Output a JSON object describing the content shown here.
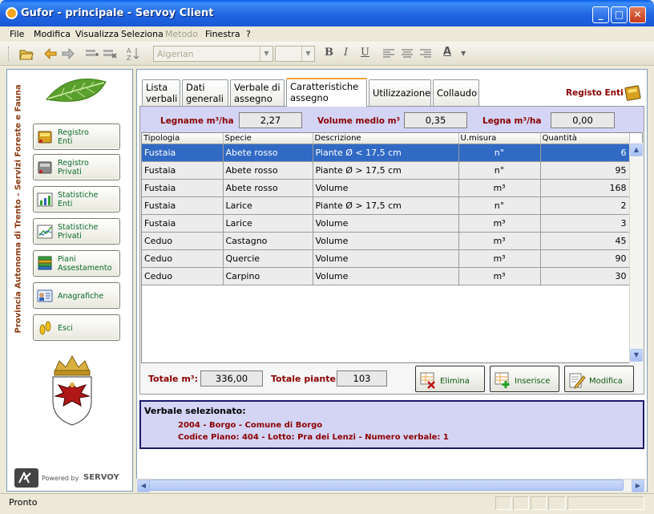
{
  "window": {
    "title": "Gufor - principale - Servoy Client",
    "min": "_",
    "max": "□",
    "close": "✕"
  },
  "menu": [
    "File",
    "Modifica",
    "Visualizza",
    "Seleziona",
    "Metodo",
    "Finestra",
    "?"
  ],
  "toolbar": {
    "font": "Algerian",
    "size": "",
    "bold": "B",
    "italic": "I",
    "underline": "U",
    "textcolor": "A"
  },
  "sidebar": {
    "vertical_label": "Provincia Autonoma di Trento - Servizi Foreste e Fauna",
    "items": [
      {
        "line1": "Registro",
        "line2": "Enti"
      },
      {
        "line1": "Registro",
        "line2": "Privati"
      },
      {
        "line1": "Statistiche",
        "line2": "Enti"
      },
      {
        "line1": "Statistiche",
        "line2": "Privati"
      },
      {
        "line1": "Piani",
        "line2": "Assestamento"
      },
      {
        "line1": "Anagrafiche",
        "line2": ""
      },
      {
        "line1": "Esci",
        "line2": ""
      }
    ],
    "powered_by": "Powered by",
    "brand": "SERVOY"
  },
  "tabs": [
    {
      "l1": "Lista",
      "l2": "verbali"
    },
    {
      "l1": "Dati",
      "l2": "generali"
    },
    {
      "l1": "Verbale di",
      "l2": "assegno"
    },
    {
      "l1": "Caratteristiche",
      "l2": "assegno"
    },
    {
      "l1": "Utilizzazione",
      "l2": ""
    },
    {
      "l1": "Collaudo",
      "l2": ""
    }
  ],
  "registo_link": "Registo Enti",
  "summary": {
    "legname_label": "Legname m³/ha",
    "legname_value": "2,27",
    "volume_label": "Volume medio m³",
    "volume_value": "0,35",
    "legna_label": "Legna m³/ha",
    "legna_value": "0,00"
  },
  "table": {
    "headers": [
      "Tipologia",
      "Specie",
      "Descrizione",
      "U.misura",
      "Quantità"
    ],
    "rows": [
      [
        "Fustaia",
        "Abete rosso",
        "Piante Ø < 17,5 cm",
        "n°",
        "6"
      ],
      [
        "Fustaia",
        "Abete rosso",
        "Piante Ø > 17,5 cm",
        "n°",
        "95"
      ],
      [
        "Fustaia",
        "Abete rosso",
        "Volume",
        "m³",
        "168"
      ],
      [
        "Fustaia",
        "Larice",
        "Piante Ø > 17,5 cm",
        "n°",
        "2"
      ],
      [
        "Fustaia",
        "Larice",
        "Volume",
        "m³",
        "3"
      ],
      [
        "Ceduo",
        "Castagno",
        "Volume",
        "m³",
        "45"
      ],
      [
        "Ceduo",
        "Quercie",
        "Volume",
        "m³",
        "90"
      ],
      [
        "Ceduo",
        "Carpino",
        "Volume",
        "m³",
        "30"
      ]
    ]
  },
  "totals": {
    "m3_label": "Totale m³:",
    "m3_value": "336,00",
    "piante_label": "Totale piante:",
    "piante_value": "103"
  },
  "actions": {
    "elimina": "Elimina",
    "inserisce": "Inserisce",
    "modifica": "Modifica"
  },
  "info": {
    "title": "Verbale selezionato:",
    "line1": "2004 - Borgo - Comune di Borgo",
    "line2": "Codice Piano: 404 - Lotto: Pra dei Lenzi - Numero verbale: 1"
  },
  "status": "Pronto"
}
